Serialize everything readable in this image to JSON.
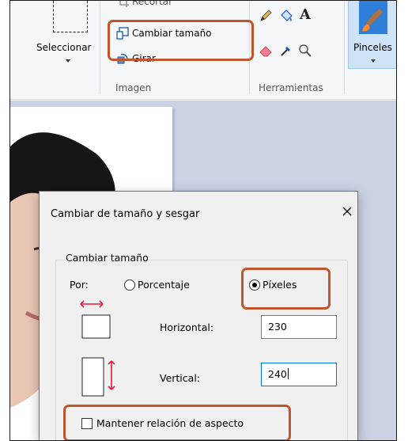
{
  "ribbon": {
    "select": {
      "label": "Seleccionar"
    },
    "image": {
      "crop_label": "Recortar",
      "resize_label": "Cambiar tamaño",
      "rotate_label": "Girar",
      "group_label": "Imagen"
    },
    "tools": {
      "group_label": "Herramientas",
      "icons": [
        "pencil-icon",
        "fill-icon",
        "text-icon",
        "eraser-icon",
        "color-picker-icon",
        "magnifier-icon"
      ],
      "text_tool_glyph": "A"
    },
    "brushes": {
      "label": "Pinceles"
    }
  },
  "dialog": {
    "title": "Cambiar de tamaño y sesgar",
    "resize_section": {
      "legend": "Cambiar tamaño",
      "by_label": "Por:",
      "options": [
        {
          "label": "Porcentaje",
          "checked": false
        },
        {
          "label": "Píxeles",
          "checked": true
        }
      ],
      "horizontal_label": "Horizontal:",
      "horizontal_value": "230",
      "vertical_label": "Vertical:",
      "vertical_value": "240",
      "maintain_aspect_label": "Mantener relación de aspecto",
      "maintain_aspect_checked": false
    }
  },
  "colors": {
    "highlight": "#c0562d",
    "ribbon_bg": "#f5f6f7",
    "canvas_bg": "#c9d3e4",
    "dialog_bg": "#f0f0f0",
    "accent_red": "#e0183a",
    "brush_selected_bg": "#cfe3f8"
  }
}
